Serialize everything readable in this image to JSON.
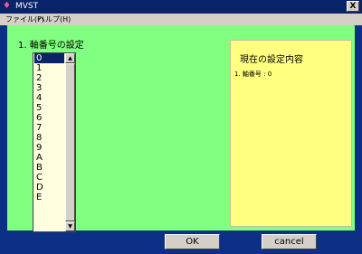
{
  "window": {
    "title": "MVST",
    "close_label": "X"
  },
  "menu": {
    "items": [
      {
        "label": "ファイル(F)"
      },
      {
        "label": "ヘルプ(H)"
      }
    ]
  },
  "section": {
    "label": "1. 軸番号の設定"
  },
  "axis_list": {
    "items": [
      "0",
      "1",
      "2",
      "3",
      "4",
      "5",
      "6",
      "7",
      "8",
      "9",
      "A",
      "B",
      "C",
      "D",
      "E"
    ],
    "selected_index": 0,
    "scroll_up": "▲",
    "scroll_down": "▼"
  },
  "current_settings": {
    "title": "現在の設定内容",
    "line1": "1. 軸番号 : 0"
  },
  "buttons": {
    "ok": "OK",
    "cancel": "cancel"
  }
}
